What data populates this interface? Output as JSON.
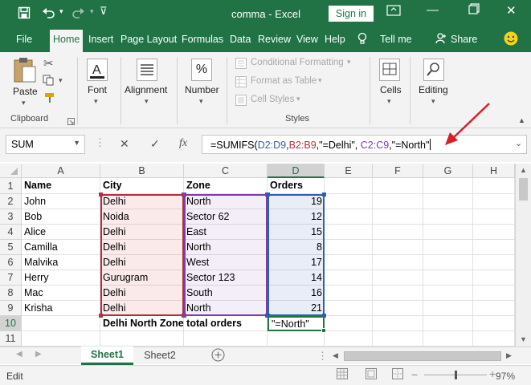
{
  "window": {
    "title": "comma  -  Excel",
    "sign_in": "Sign in",
    "restore_icon": "ribbon-display-icon"
  },
  "tabs": [
    "File",
    "Home",
    "Insert",
    "Page Layout",
    "Formulas",
    "Data",
    "Review",
    "View",
    "Help",
    "Tell me",
    "Share"
  ],
  "ribbon": {
    "clipboard": {
      "paste": "Paste",
      "group": "Clipboard"
    },
    "font": "Font",
    "alignment": "Alignment",
    "number": "Number",
    "number_symbol": "%",
    "styles": {
      "conditional": "Conditional Formatting",
      "table": "Format as Table",
      "cell_styles": "Cell Styles",
      "group": "Styles"
    },
    "cells": "Cells",
    "editing": "Editing"
  },
  "formula_bar": {
    "name_box": "SUM",
    "fx": "fx",
    "parts": [
      {
        "t": "=SUMIFS(",
        "c": "#000000"
      },
      {
        "t": "D2:D9",
        "c": "#2e5fa8"
      },
      {
        "t": ",",
        "c": "#000000"
      },
      {
        "t": "B2:B9",
        "c": "#b0303f"
      },
      {
        "t": ",\"=Delhi\", ",
        "c": "#000000"
      },
      {
        "t": "C2:C9",
        "c": "#7a3fa0"
      },
      {
        "t": ",\"=North\"",
        "c": "#000000"
      }
    ]
  },
  "columns": [
    "A",
    "B",
    "C",
    "D",
    "E",
    "F",
    "G",
    "H"
  ],
  "rows": [
    "1",
    "2",
    "3",
    "4",
    "5",
    "6",
    "7",
    "8",
    "9",
    "10",
    "11"
  ],
  "table": {
    "headers": [
      "Name",
      "City",
      "Zone",
      "Orders"
    ],
    "data": [
      [
        "John",
        "Delhi",
        "North",
        "19"
      ],
      [
        "Bob",
        "Noida",
        "Sector 62",
        "12"
      ],
      [
        "Alice",
        "Delhi",
        "East",
        "15"
      ],
      [
        "Camilla",
        "Delhi",
        "North",
        "8"
      ],
      [
        "Malvika",
        "Delhi",
        "West",
        "17"
      ],
      [
        "Herry",
        "Gurugram",
        "Sector 123",
        "14"
      ],
      [
        "Mac",
        "Delhi",
        "South",
        "16"
      ],
      [
        "Krisha",
        "Delhi",
        "North",
        "21"
      ]
    ],
    "summary_label": "Delhi North Zone total orders",
    "active_cell_value": "\"=North\""
  },
  "sheets": [
    "Sheet1",
    "Sheet2"
  ],
  "status": {
    "mode": "Edit",
    "zoom": "97%"
  },
  "colors": {
    "brand": "#217346",
    "range_b": "#b0303f",
    "range_c": "#7a3fa0",
    "range_d": "#2e5fa8",
    "arrow": "#d81f26"
  }
}
